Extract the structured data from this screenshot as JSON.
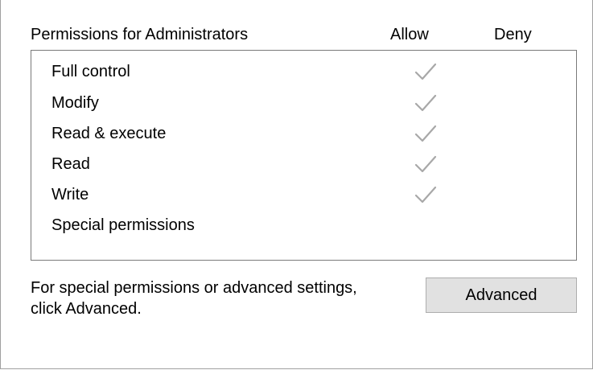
{
  "header": {
    "title": "Permissions for Administrators",
    "allow_label": "Allow",
    "deny_label": "Deny"
  },
  "permissions": [
    {
      "label": "Full control",
      "allow": true,
      "deny": false
    },
    {
      "label": "Modify",
      "allow": true,
      "deny": false
    },
    {
      "label": "Read & execute",
      "allow": true,
      "deny": false
    },
    {
      "label": "Read",
      "allow": true,
      "deny": false
    },
    {
      "label": "Write",
      "allow": true,
      "deny": false
    },
    {
      "label": "Special permissions",
      "allow": false,
      "deny": false
    }
  ],
  "footer": {
    "line1": "For special permissions or advanced settings,",
    "line2": "click Advanced."
  },
  "advanced_button": {
    "label": "Advanced"
  },
  "colors": {
    "check_disabled": "#a8a8a8",
    "list_border": "#7a7a7a",
    "button_bg": "#e1e1e1",
    "button_border": "#adadad"
  },
  "icons": {
    "allow_check": "checkmark-icon"
  }
}
